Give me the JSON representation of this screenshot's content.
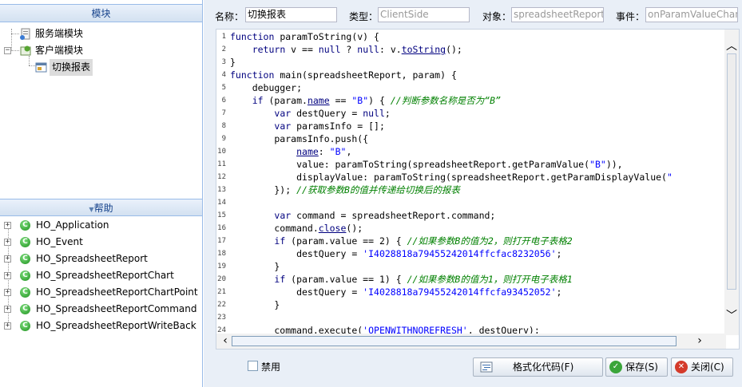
{
  "modules": {
    "header": "模块",
    "items": [
      {
        "label": "服务端模块",
        "icon": "server-module-icon"
      },
      {
        "label": "客户端模块",
        "icon": "client-module-icon"
      },
      {
        "label": "切换报表",
        "icon": "macro-file-icon"
      }
    ]
  },
  "help": {
    "header": "帮助",
    "items": [
      "HO_Application",
      "HO_Event",
      "HO_SpreadsheetReport",
      "HO_SpreadsheetReportChart",
      "HO_SpreadsheetReportChartPoint",
      "HO_SpreadsheetReportCommand",
      "HO_SpreadsheetReportWriteBack"
    ],
    "item_icon_letter": "C"
  },
  "form": {
    "name_label": "名称：",
    "name_value": "切换报表",
    "type_label": "类型：",
    "type_value": "ClientSide",
    "object_label": "对象：",
    "object_value": "spreadsheetReport",
    "event_label": "事件：",
    "event_value": "onParamValueChan"
  },
  "editor": {
    "line_numbers": [
      "1",
      "2",
      "3",
      "4",
      "5",
      "6",
      "7",
      "8",
      "9",
      "10",
      "11",
      "12",
      "13",
      "14",
      "15",
      "16",
      "17",
      "18",
      "19",
      "20",
      "21",
      "22",
      "23",
      "24"
    ]
  },
  "footer": {
    "disable_label": "禁用",
    "format_button": "格式化代码(F)",
    "save_button": "保存(S)",
    "close_button": "关闭(C)"
  },
  "colors": {
    "keyword": "#00007f",
    "string": "#0000ff",
    "comment": "#008000",
    "panel_border": "#99bbe8",
    "panel_bg": "#e9eff7"
  }
}
